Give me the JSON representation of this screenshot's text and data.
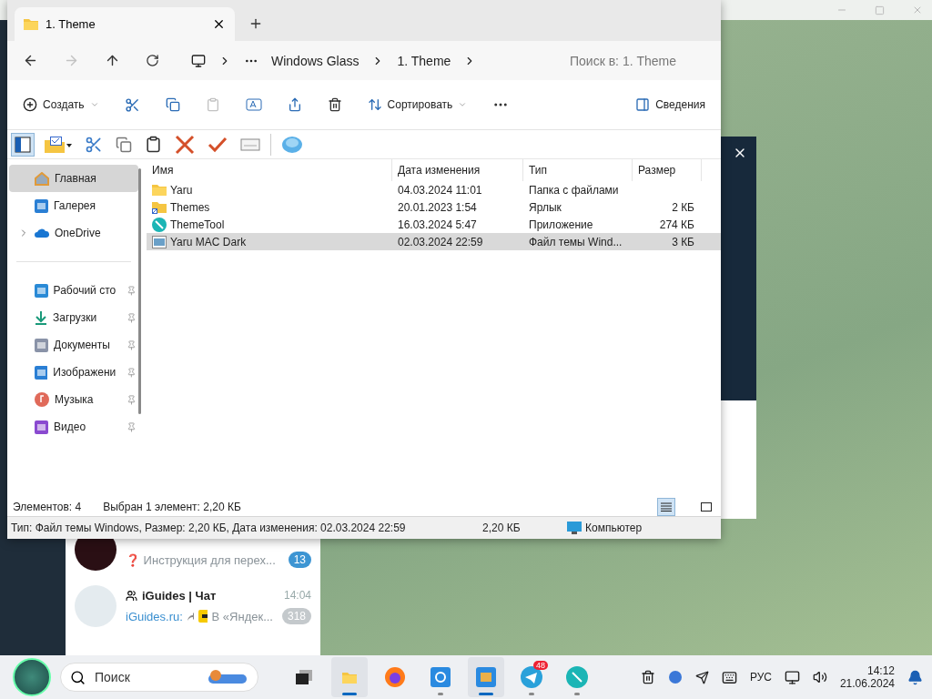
{
  "telegram": {
    "chats": [
      {
        "kind": "channel",
        "preview": "❓ Инструкция для перех...",
        "badge": "13",
        "muted": false
      },
      {
        "kind": "group",
        "name": "iGuides | Чат",
        "time": "14:04",
        "sender": "iGuides.ru:",
        "preview": "В «Яндек...",
        "badge": "318",
        "muted": true
      }
    ]
  },
  "explorer": {
    "tab": {
      "title": "1. Theme"
    },
    "breadcrumb": [
      "Windows Glass",
      "1. Theme"
    ],
    "search": {
      "placeholder": "Поиск в: 1. Theme"
    },
    "commands": {
      "create": "Создать",
      "sort": "Сортировать",
      "details": "Сведения"
    },
    "sidebar": {
      "groups": [
        [
          {
            "kind": "home",
            "label": "Главная",
            "selected": true,
            "pinned": false,
            "expandable": false
          },
          {
            "kind": "gallery",
            "label": "Галерея",
            "selected": false,
            "pinned": false,
            "expandable": false
          },
          {
            "kind": "cloud",
            "label": "OneDrive",
            "selected": false,
            "pinned": false,
            "expandable": true
          }
        ],
        [
          {
            "kind": "desktop",
            "label": "Рабочий сто",
            "selected": false,
            "pinned": true,
            "expandable": false
          },
          {
            "kind": "download",
            "label": "Загрузки",
            "selected": false,
            "pinned": true,
            "expandable": false
          },
          {
            "kind": "document",
            "label": "Документы",
            "selected": false,
            "pinned": true,
            "expandable": false
          },
          {
            "kind": "gallery",
            "label": "Изображени",
            "selected": false,
            "pinned": true,
            "expandable": false
          },
          {
            "kind": "music",
            "label": "Музыка",
            "selected": false,
            "pinned": true,
            "expandable": false
          },
          {
            "kind": "video",
            "label": "Видео",
            "selected": false,
            "pinned": true,
            "expandable": false
          }
        ]
      ]
    },
    "table": {
      "columns": [
        "Имя",
        "Дата изменения",
        "Тип",
        "Размер"
      ],
      "rows": [
        {
          "kind": "folder",
          "name": "Yaru",
          "date": "04.03.2024 11:01",
          "type": "Папка с файлами",
          "selected": false
        },
        {
          "kind": "shortcut",
          "name": "Themes",
          "date": "20.01.2023 1:54",
          "type": "Ярлык",
          "size": "2 КБ",
          "selected": false
        },
        {
          "kind": "app",
          "name": "ThemeTool",
          "date": "16.03.2024 5:47",
          "type": "Приложение",
          "size": "274 КБ",
          "selected": false
        },
        {
          "kind": "theme",
          "name": "Yaru MAC Dark",
          "date": "02.03.2024 22:59",
          "type": "Файл темы Wind...",
          "size": "3 КБ",
          "selected": true
        }
      ]
    },
    "status": {
      "count": "Элементов: 4",
      "selection": "Выбран 1 элемент: 2,20 КБ"
    },
    "view_modes": [
      {
        "kind": "details",
        "selected": true
      },
      {
        "kind": "tiles",
        "selected": false
      }
    ],
    "classic_status": {
      "info": "Тип: Файл темы Windows, Размер: 2,20 КБ, Дата изменения: 02.03.2024 22:59",
      "size": "2,20 КБ",
      "location": "Компьютер"
    }
  },
  "taskbar": {
    "search": {
      "placeholder": "Поиск"
    },
    "apps": [
      {
        "kind": "taskview",
        "open": false,
        "selected": false
      },
      {
        "kind": "explorer",
        "open": true,
        "selected": true
      },
      {
        "kind": "firefox",
        "open": false,
        "selected": false
      },
      {
        "kind": "sync",
        "open": true,
        "selected": false
      },
      {
        "kind": "package",
        "open": true,
        "selected": true
      },
      {
        "kind": "telegram",
        "open": true,
        "selected": false,
        "badge": "48"
      },
      {
        "kind": "tool",
        "open": true,
        "selected": false
      }
    ],
    "language": "РУС",
    "time": "14:12",
    "date": "21.06.2024"
  }
}
